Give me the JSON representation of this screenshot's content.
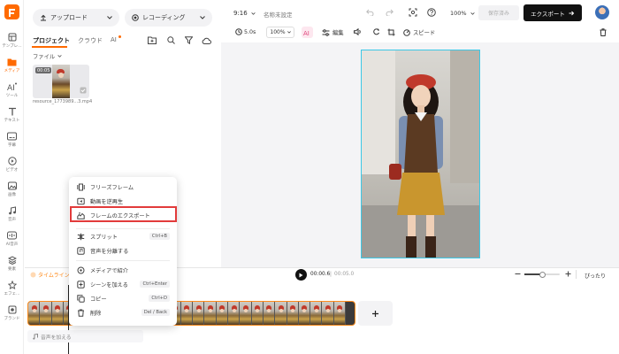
{
  "rail": {
    "items": [
      {
        "label": "テンプレ…",
        "icon": "template-icon"
      },
      {
        "label": "メディア",
        "icon": "media-folder-icon"
      },
      {
        "label": "ツール",
        "icon": "ai-tools-icon"
      },
      {
        "label": "テキスト",
        "icon": "text-icon"
      },
      {
        "label": "字幕",
        "icon": "subtitle-icon"
      },
      {
        "label": "ビデオ",
        "icon": "video-icon"
      },
      {
        "label": "画像",
        "icon": "image-icon"
      },
      {
        "label": "音声",
        "icon": "music-icon"
      },
      {
        "label": "AI音声",
        "icon": "ai-voice-icon"
      },
      {
        "label": "要素",
        "icon": "elements-icon"
      },
      {
        "label": "エフェ…",
        "icon": "effects-icon"
      },
      {
        "label": "ブランド",
        "icon": "brand-icon"
      }
    ]
  },
  "panel": {
    "upload_label": "アップロード",
    "record_label": "レコーディング",
    "tabs": [
      "プロジェクト",
      "クラウド",
      "AI"
    ],
    "filter_label": "ファイル",
    "thumb_duration": "00:05",
    "thumb_name": "resource_1773989...3.mp4"
  },
  "topbar": {
    "aspect": "9:16",
    "project_title": "名称未設定",
    "zoom": "100%",
    "saved_label": "保存済み",
    "export_label": "エクスポート"
  },
  "toolbar": {
    "duration": "5.0s",
    "zoom": "100%",
    "edit_label": "編集",
    "speed_label": "スピード"
  },
  "timeline": {
    "label": "タイムライン",
    "time_current": "00:00.6",
    "time_total": "00:05.0",
    "fit_label": "ぴったり",
    "add_audio_label": "音声を加える"
  },
  "context_menu": {
    "items": [
      {
        "label": "フリーズフレーム",
        "icon": "freeze-frame-icon",
        "shortcut": ""
      },
      {
        "label": "動画を逆再生",
        "icon": "reverse-icon",
        "shortcut": ""
      },
      {
        "label": "フレームのエクスポート",
        "icon": "frame-export-icon",
        "shortcut": ""
      },
      {
        "label": "スプリット",
        "icon": "split-icon",
        "shortcut": "Ctrl+B"
      },
      {
        "label": "音声を分離する",
        "icon": "audio-detach-icon",
        "shortcut": ""
      },
      {
        "label": "メディアで紹介",
        "icon": "locate-icon",
        "shortcut": ""
      },
      {
        "label": "シーンを加える",
        "icon": "add-scene-icon",
        "shortcut": "Ctrl+Enter"
      },
      {
        "label": "コピー",
        "icon": "copy-icon",
        "shortcut": "Ctrl+D"
      },
      {
        "label": "削除",
        "icon": "trash-icon",
        "shortcut": "Del / Back"
      }
    ]
  },
  "colors": {
    "accent": "#ff6a00",
    "highlight": "#e23b3b",
    "preview_border": "#3cc8e6",
    "track_border": "#ff8a1a"
  }
}
